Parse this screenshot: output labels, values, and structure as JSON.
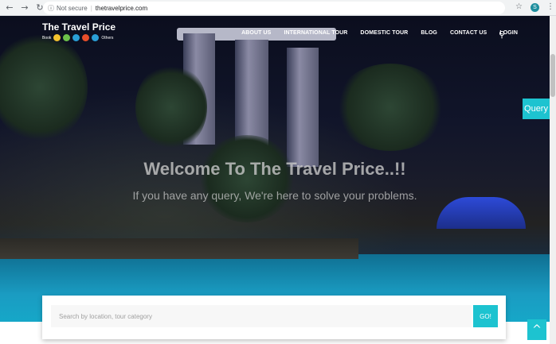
{
  "browser": {
    "back_icon": "←",
    "forward_icon": "→",
    "reload_icon": "↻",
    "info_icon": "ⓘ",
    "security_label": "Not secure",
    "url": "thetravelprice.com",
    "star_icon": "☆",
    "profile_initial": "S",
    "menu_icon": "⋮"
  },
  "site": {
    "brand_title": "The Travel Price",
    "brand_sub_left": "Book",
    "brand_sub_right": "Others",
    "brand_icon_colors": [
      "#f2c12e",
      "#6cc04a",
      "#2a9fd6",
      "#e94e2a",
      "#2a9fd6"
    ]
  },
  "nav": {
    "items": [
      "ABOUT US",
      "INTERNATIONAL TOUR",
      "DOMESTIC TOUR",
      "BLOG",
      "CONTACT US",
      "LOGIN"
    ],
    "search_icon": "⚲"
  },
  "query_tab": "Query",
  "hero": {
    "welcome": "Welcome To The Travel Price..!!",
    "tagline": "If you have any query, We're here to solve your problems."
  },
  "search": {
    "placeholder": "Search by location, tour category",
    "button": "GO!"
  },
  "scroll_top_icon": "^",
  "colors": {
    "accent": "#1dc3d0"
  }
}
